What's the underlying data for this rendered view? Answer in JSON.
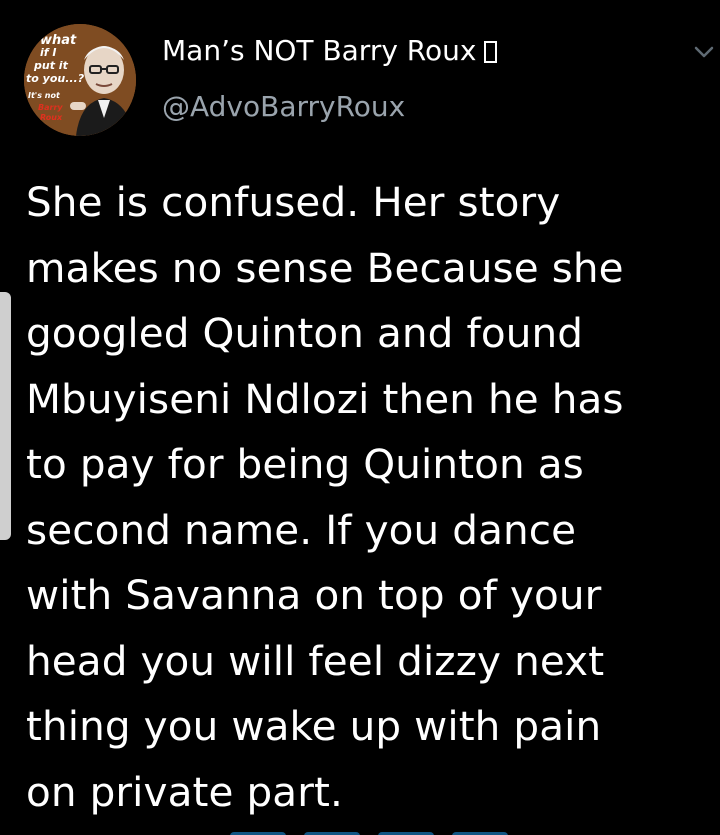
{
  "author": {
    "display_name": "Man’s NOT Barry Roux",
    "handle": "@AdvoBarryRoux",
    "avatar": {
      "text_lines": [
        "what",
        "if I",
        "put it",
        "to you...?",
        "It's not",
        "Barry",
        "Roux"
      ]
    }
  },
  "tweet": {
    "text": "She is confused. Her story\nmakes no sense Because she\ngoogled Quinton and found\nMbuyiseni Ndlozi then he has\nto pay for being Quinton as\nsecond name. If you dance\nwith Savanna on top of your\nhead you will feel dizzy next\nthing you wake up with pain\non private part."
  },
  "icons": {
    "menu": "chevron-down-icon"
  },
  "colors": {
    "background": "#000000",
    "text": "#ffffff",
    "handle": "#9aa4ad",
    "link": "#1d9bf0"
  }
}
